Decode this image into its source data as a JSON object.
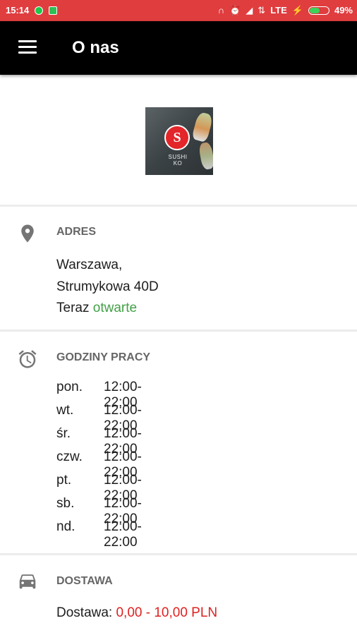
{
  "status_bar": {
    "time": "15:14",
    "network": "LTE",
    "battery": "49%",
    "battery_level": 0.49
  },
  "app_bar": {
    "title": "O nas"
  },
  "logo": {
    "brand_text": "SUSHI KO"
  },
  "address": {
    "heading": "ADRES",
    "city": "Warszawa,",
    "street": "Strumykowa 40D",
    "now_label": "Teraz",
    "status": "otwarte"
  },
  "hours": {
    "heading": "GODZINY PRACY",
    "rows": [
      {
        "day": "pon.",
        "time": "12:00-22:00"
      },
      {
        "day": "wt.",
        "time": "12:00-22:00"
      },
      {
        "day": "śr.",
        "time": "12:00-22:00"
      },
      {
        "day": "czw.",
        "time": "12:00-22:00"
      },
      {
        "day": "pt.",
        "time": "12:00-22:00"
      },
      {
        "day": "sb.",
        "time": "12:00-22:00"
      },
      {
        "day": "nd.",
        "time": "12:00-22:00"
      }
    ]
  },
  "delivery": {
    "heading": "DOSTAWA",
    "label": "Dostawa:",
    "price": "0,00 - 10,00 PLN"
  },
  "icons": {
    "menu": "hamburger-menu-icon",
    "location": "location-pin-icon",
    "alarm": "alarm-clock-icon",
    "car": "car-icon"
  },
  "colors": {
    "status_bar": "#e03d3f",
    "app_bar": "#000000",
    "open_green": "#43a047",
    "price_red": "#e02020"
  }
}
